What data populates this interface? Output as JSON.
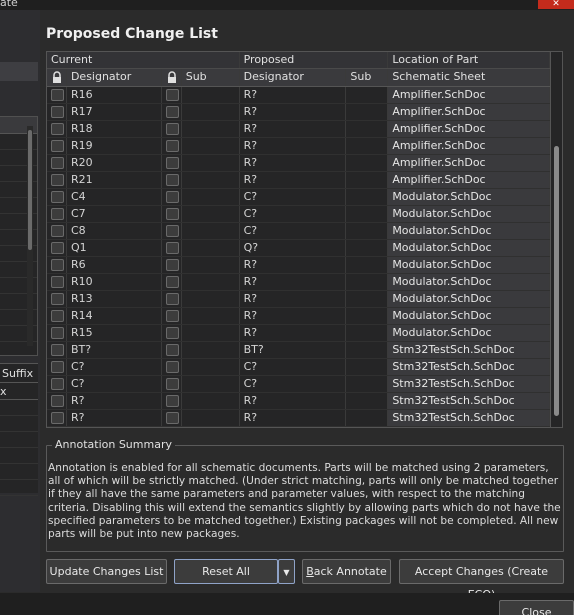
{
  "window": {
    "title_fragment": "ate",
    "close_glyph": "✕"
  },
  "left_panel": {
    "header_suffix": "Suffix",
    "header_second": "x"
  },
  "section_title": "Proposed Change List",
  "grid": {
    "groups": {
      "current": "Current",
      "proposed": "Proposed",
      "location": "Location of Part"
    },
    "columns": {
      "designator": "Designator",
      "sub": "Sub",
      "proposed_designator": "Designator",
      "proposed_sub": "Sub",
      "schematic_sheet": "Schematic Sheet"
    },
    "rows": [
      {
        "current": "R16",
        "proposed": "R?",
        "sheet": "Amplifier.SchDoc"
      },
      {
        "current": "R17",
        "proposed": "R?",
        "sheet": "Amplifier.SchDoc"
      },
      {
        "current": "R18",
        "proposed": "R?",
        "sheet": "Amplifier.SchDoc"
      },
      {
        "current": "R19",
        "proposed": "R?",
        "sheet": "Amplifier.SchDoc"
      },
      {
        "current": "R20",
        "proposed": "R?",
        "sheet": "Amplifier.SchDoc"
      },
      {
        "current": "R21",
        "proposed": "R?",
        "sheet": "Amplifier.SchDoc"
      },
      {
        "current": "C4",
        "proposed": "C?",
        "sheet": "Modulator.SchDoc"
      },
      {
        "current": "C7",
        "proposed": "C?",
        "sheet": "Modulator.SchDoc"
      },
      {
        "current": "C8",
        "proposed": "C?",
        "sheet": "Modulator.SchDoc"
      },
      {
        "current": "Q1",
        "proposed": "Q?",
        "sheet": "Modulator.SchDoc"
      },
      {
        "current": "R6",
        "proposed": "R?",
        "sheet": "Modulator.SchDoc"
      },
      {
        "current": "R10",
        "proposed": "R?",
        "sheet": "Modulator.SchDoc"
      },
      {
        "current": "R13",
        "proposed": "R?",
        "sheet": "Modulator.SchDoc"
      },
      {
        "current": "R14",
        "proposed": "R?",
        "sheet": "Modulator.SchDoc"
      },
      {
        "current": "R15",
        "proposed": "R?",
        "sheet": "Modulator.SchDoc"
      },
      {
        "current": "BT?",
        "proposed": "BT?",
        "sheet": "Stm32TestSch.SchDoc"
      },
      {
        "current": "C?",
        "proposed": "C?",
        "sheet": "Stm32TestSch.SchDoc"
      },
      {
        "current": "C?",
        "proposed": "C?",
        "sheet": "Stm32TestSch.SchDoc"
      },
      {
        "current": "R?",
        "proposed": "R?",
        "sheet": "Stm32TestSch.SchDoc"
      },
      {
        "current": "R?",
        "proposed": "R?",
        "sheet": "Stm32TestSch.SchDoc"
      }
    ]
  },
  "summary": {
    "legend": "Annotation Summary",
    "text": "Annotation is enabled for all schematic documents. Parts will be matched using 2 parameters, all of which will be strictly matched. (Under strict matching, parts will only be matched together if they all have the same parameters and parameter values, with respect to the matching criteria. Disabling this will extend the semantics slightly by allowing parts which do not have the specified parameters to be matched together.) Existing packages will not be completed. All new parts will be put into new packages."
  },
  "buttons": {
    "update": "Update Changes List",
    "reset": "Reset All",
    "reset_dropdown_glyph": "▼",
    "back_annotate_first": "B",
    "back_annotate_rest": "ack Annotate",
    "accept": "Accept Changes (Create ECO)",
    "close": "Close"
  }
}
